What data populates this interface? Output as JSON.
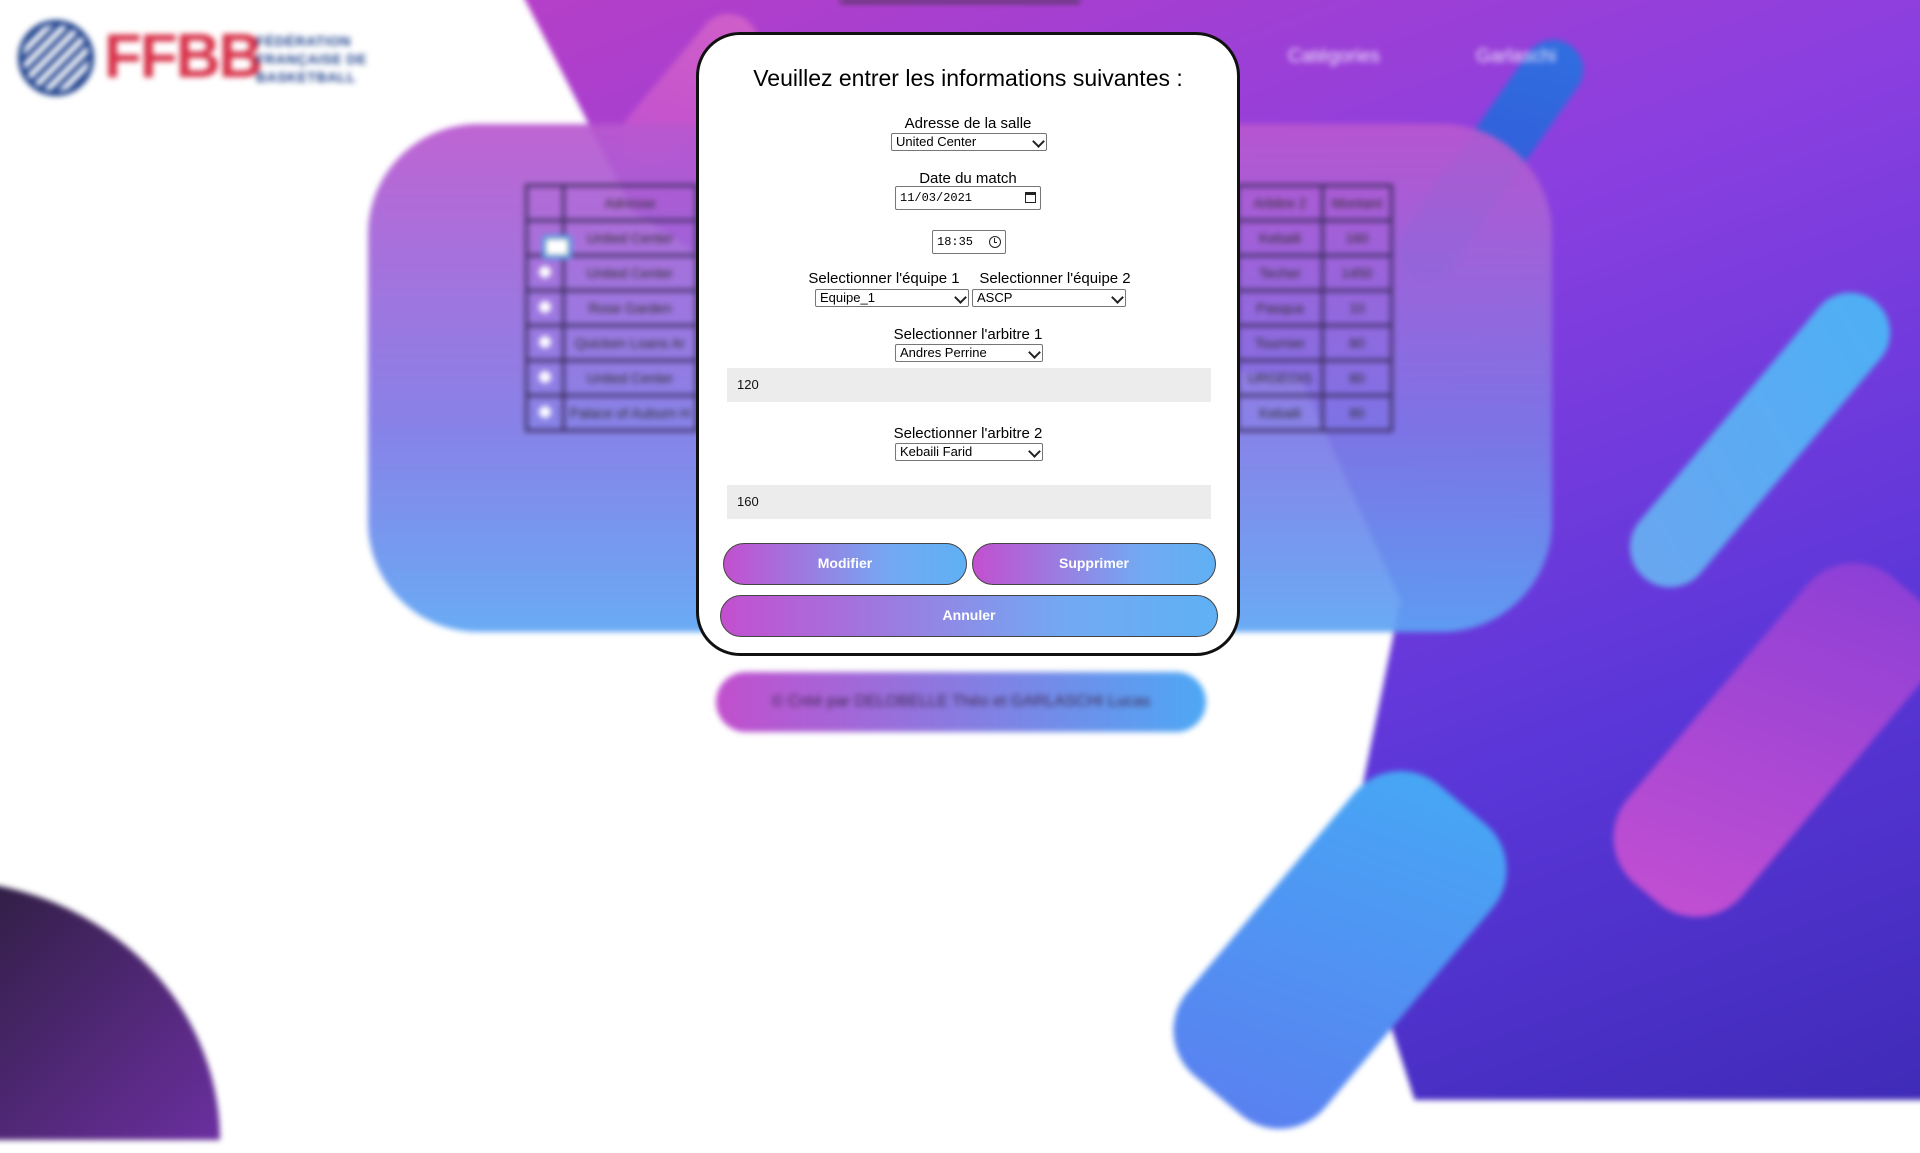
{
  "colors": {
    "accent_gradient_start": "#c34fcf",
    "accent_gradient_end": "#5fb0f5",
    "modal_border": "#111111",
    "input_fill": "#ececec"
  },
  "background": {
    "logo": {
      "letters": "FFBB",
      "sub1": "FÉDÉRATION",
      "sub2": "FRANÇAISE DE",
      "sub3": "BASKETBALL"
    },
    "nav": [
      "Catégories",
      "Garlaschi"
    ],
    "table": {
      "headers": {
        "adresse": "Adresse",
        "arbitre2": "Arbitre 2",
        "montant": "Montant"
      },
      "rows": [
        {
          "adresse": "United Center",
          "arbitre2": "Kebaili",
          "montant": "160"
        },
        {
          "adresse": "United Center",
          "arbitre2": "Techer",
          "montant": "1450"
        },
        {
          "adresse": "Rose Garden",
          "arbitre2": "Pasqua",
          "montant": "10"
        },
        {
          "adresse": "Quicken Loans Ar",
          "arbitre2": "Tournier",
          "montant": "80"
        },
        {
          "adresse": "United Center",
          "arbitre2": "URGEOIS",
          "montant": "80"
        },
        {
          "adresse": "Palace of Auburn H",
          "arbitre2": "Kebaili",
          "montant": "80"
        }
      ]
    },
    "footer": "© Créé par DELOBELLE Théo et GARLASCHI Lucas"
  },
  "modal": {
    "title": "Veuillez entrer les informations suivantes :",
    "adresse": {
      "label": "Adresse de la salle",
      "value": "United Center"
    },
    "date": {
      "label": "Date du match",
      "value": "11/03/2021"
    },
    "time": {
      "value": "18:35"
    },
    "equipe1": {
      "label": "Selectionner l'équipe 1",
      "value": "Equipe_1"
    },
    "equipe2": {
      "label": "Selectionner l'équipe 2",
      "value": "ASCP"
    },
    "arbitre1": {
      "label": "Selectionner l'arbitre 1",
      "value": "Andres Perrine",
      "montant": "120"
    },
    "arbitre2": {
      "label": "Selectionner l'arbitre 2",
      "value": "Kebaili Farid",
      "montant": "160"
    },
    "buttons": {
      "modifier": "Modifier",
      "supprimer": "Supprimer",
      "annuler": "Annuler"
    }
  }
}
